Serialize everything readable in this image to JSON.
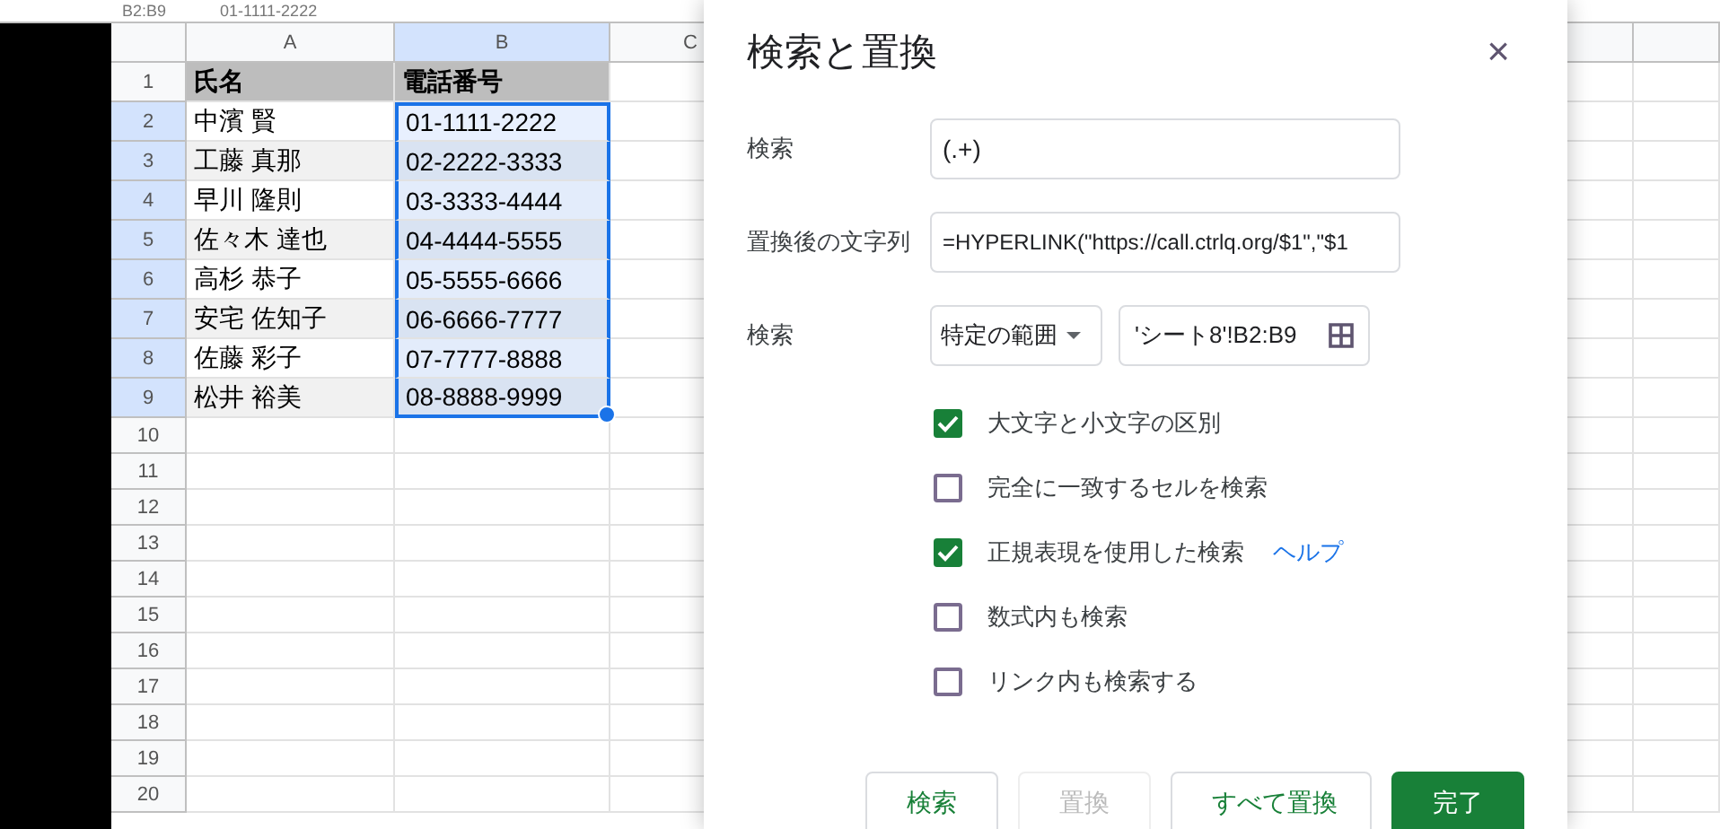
{
  "formula_bar": {
    "cell_ref": "B2:B9",
    "formula": "01-1111-2222"
  },
  "sheet": {
    "columns": [
      {
        "label": "A",
        "selected": false
      },
      {
        "label": "B",
        "selected": true
      },
      {
        "label": "C",
        "selected": false
      }
    ],
    "rows": [
      {
        "number": "1",
        "selected": false,
        "kind": "header",
        "cells": [
          "氏名",
          "電話番号"
        ]
      },
      {
        "number": "2",
        "selected": true,
        "kind": "data",
        "cells": [
          "中濱 賢",
          "01-1111-2222"
        ]
      },
      {
        "number": "3",
        "selected": true,
        "kind": "data",
        "cells": [
          "工藤 真那",
          "02-2222-3333"
        ]
      },
      {
        "number": "4",
        "selected": true,
        "kind": "data",
        "cells": [
          "早川 隆則",
          "03-3333-4444"
        ]
      },
      {
        "number": "5",
        "selected": true,
        "kind": "data",
        "cells": [
          "佐々木 達也",
          "04-4444-5555"
        ]
      },
      {
        "number": "6",
        "selected": true,
        "kind": "data",
        "cells": [
          "高杉 恭子",
          "05-5555-6666"
        ]
      },
      {
        "number": "7",
        "selected": true,
        "kind": "data",
        "cells": [
          "安宅 佐知子",
          "06-6666-7777"
        ]
      },
      {
        "number": "8",
        "selected": true,
        "kind": "data",
        "cells": [
          "佐藤 彩子",
          "07-7777-8888"
        ]
      },
      {
        "number": "9",
        "selected": true,
        "kind": "data",
        "cells": [
          "松井 裕美",
          "08-8888-9999"
        ]
      },
      {
        "number": "10",
        "selected": false,
        "kind": "empty",
        "cells": []
      },
      {
        "number": "11",
        "selected": false,
        "kind": "empty",
        "cells": []
      },
      {
        "number": "12",
        "selected": false,
        "kind": "empty",
        "cells": []
      },
      {
        "number": "13",
        "selected": false,
        "kind": "empty",
        "cells": []
      },
      {
        "number": "14",
        "selected": false,
        "kind": "empty",
        "cells": []
      },
      {
        "number": "15",
        "selected": false,
        "kind": "empty",
        "cells": []
      },
      {
        "number": "16",
        "selected": false,
        "kind": "empty",
        "cells": []
      },
      {
        "number": "17",
        "selected": false,
        "kind": "empty",
        "cells": []
      },
      {
        "number": "18",
        "selected": false,
        "kind": "empty",
        "cells": []
      },
      {
        "number": "19",
        "selected": false,
        "kind": "empty",
        "cells": []
      },
      {
        "number": "20",
        "selected": false,
        "kind": "empty",
        "cells": []
      }
    ]
  },
  "dialog": {
    "title": "検索と置換",
    "close": "×",
    "fields": [
      {
        "label": "検索",
        "value": "(.+)"
      },
      {
        "label": "置換後の文字列",
        "value": "=HYPERLINK(\"https://call.ctrlq.org/$1\",\"$1"
      }
    ],
    "scope": {
      "label": "検索",
      "dropdown": "特定の範囲",
      "range": "'シート8'!B2:B9"
    },
    "options": [
      {
        "label": "大文字と小文字の区別",
        "checked": true
      },
      {
        "label": "完全に一致するセルを検索",
        "checked": false
      },
      {
        "label": "正規表現を使用した検索",
        "checked": true,
        "link": "ヘルプ"
      },
      {
        "label": "数式内も検索",
        "checked": false
      },
      {
        "label": "リンク内も検索する",
        "checked": false
      }
    ],
    "buttons": [
      {
        "label": "検索",
        "kind": "default",
        "disabled": false
      },
      {
        "label": "置換",
        "kind": "default",
        "disabled": true
      },
      {
        "label": "すべて置換",
        "kind": "default",
        "disabled": false
      },
      {
        "label": "完了",
        "kind": "primary",
        "disabled": false
      }
    ]
  }
}
